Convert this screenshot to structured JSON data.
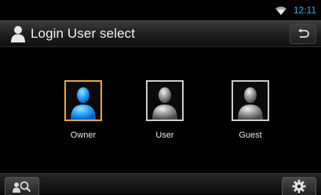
{
  "status": {
    "time": "12:11",
    "wifi_icon": "wifi-icon"
  },
  "header": {
    "title": "Login User select",
    "title_icon": "person-icon",
    "back_icon": "back-arrow-icon"
  },
  "users": [
    {
      "label": "Owner",
      "selected": true
    },
    {
      "label": "User",
      "selected": false
    },
    {
      "label": "Guest",
      "selected": false
    }
  ],
  "footer": {
    "left_icon": "user-search-icon",
    "right_icon": "gear-icon"
  },
  "colors": {
    "accent_clock": "#27b7ff",
    "selected_border": "#f2a82b",
    "owner_avatar": "#2aa8ff"
  }
}
